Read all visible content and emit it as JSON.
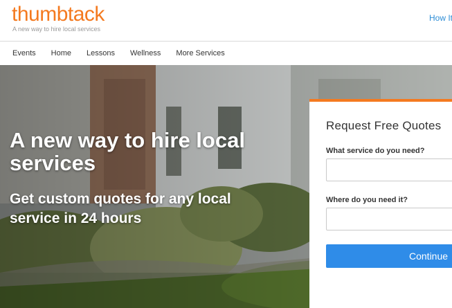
{
  "header": {
    "logo_text": "thumbtack",
    "tagline": "A new way to hire local services",
    "how_it_link": "How It"
  },
  "nav": {
    "items": [
      {
        "label": "Events"
      },
      {
        "label": "Home"
      },
      {
        "label": "Lessons"
      },
      {
        "label": "Wellness"
      },
      {
        "label": "More Services"
      }
    ]
  },
  "hero": {
    "title": "A new way to hire local services",
    "subtitle": "Get custom quotes for any local service in 24 hours"
  },
  "quote_form": {
    "title": "Request Free Quotes",
    "service_label": "What service do you need?",
    "service_value": "",
    "location_label": "Where do you need it?",
    "location_value": "",
    "continue_label": "Continue"
  },
  "colors": {
    "brand_orange": "#f47a20",
    "link_blue": "#2d8dd6",
    "button_blue": "#2f8ce8"
  },
  "icons": {
    "hero_background": "house-photo-image"
  }
}
